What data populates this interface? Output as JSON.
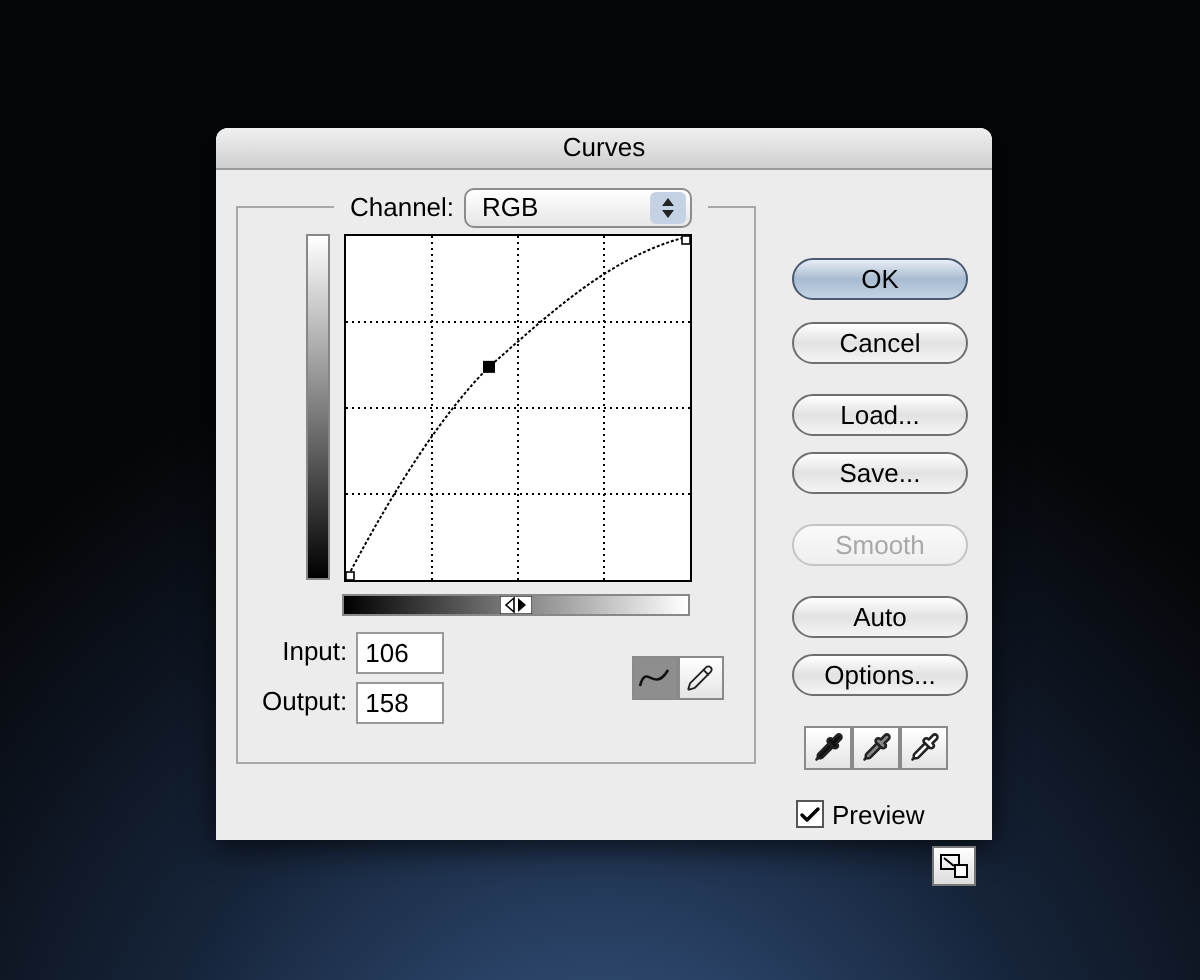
{
  "window": {
    "title": "Curves"
  },
  "channel": {
    "label": "Channel:",
    "value": "RGB"
  },
  "point": {
    "input_label": "Input:",
    "input": "106",
    "output_label": "Output:",
    "output": "158"
  },
  "tools": [
    {
      "kind": "curve",
      "selected": true
    },
    {
      "kind": "pencil",
      "selected": false
    }
  ],
  "buttons": [
    {
      "label": "OK",
      "kind": "default",
      "disabled": false
    },
    {
      "label": "Cancel",
      "kind": "plain",
      "disabled": false
    },
    {
      "label": "Load...",
      "kind": "plain",
      "disabled": false
    },
    {
      "label": "Save...",
      "kind": "plain",
      "disabled": false
    },
    {
      "label": "Smooth",
      "kind": "plain",
      "disabled": true
    },
    {
      "label": "Auto",
      "kind": "plain",
      "disabled": false
    },
    {
      "label": "Options...",
      "kind": "plain",
      "disabled": false
    }
  ],
  "eyedroppers": [
    {
      "kind": "black"
    },
    {
      "kind": "gray"
    },
    {
      "kind": "white"
    }
  ],
  "preview": {
    "label": "Preview",
    "checked": true
  }
}
